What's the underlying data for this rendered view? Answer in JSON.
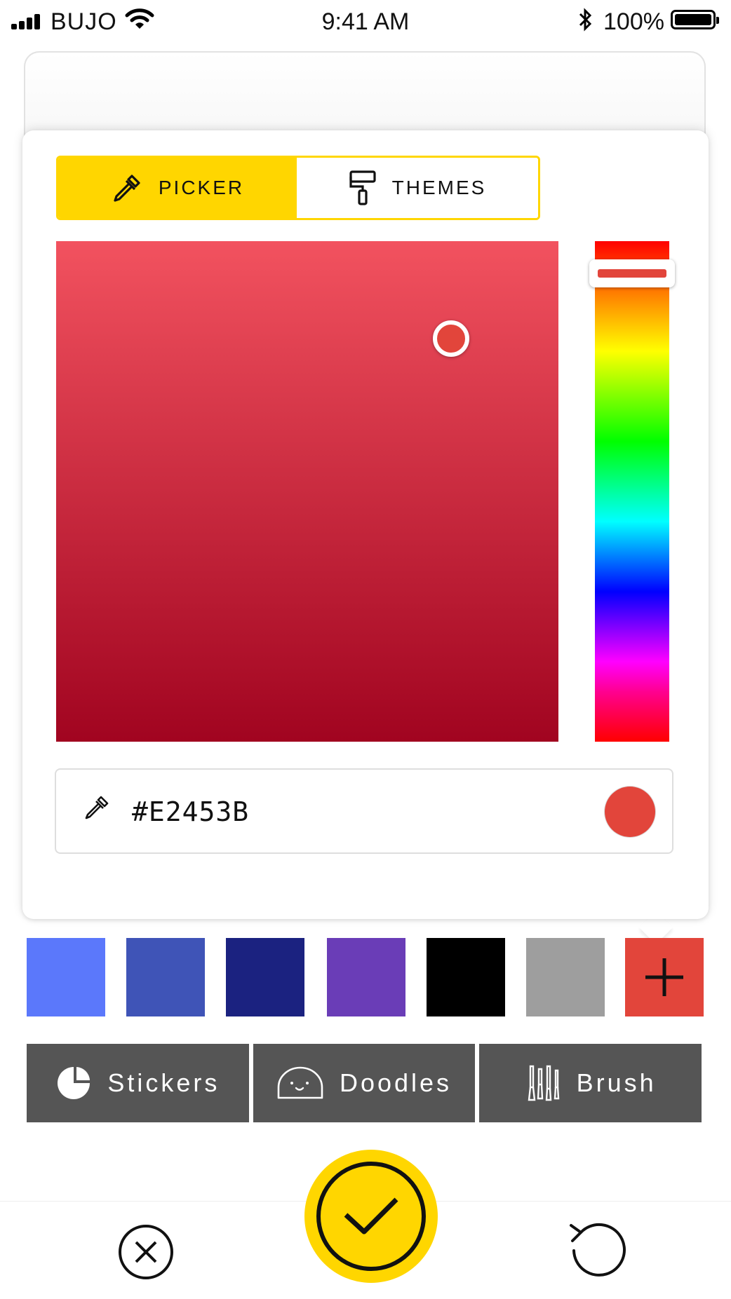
{
  "status_bar": {
    "carrier": "BUJO",
    "time": "9:41 AM",
    "battery": "100%"
  },
  "picker": {
    "tabs": [
      {
        "label": "PICKER",
        "icon": "eyedropper-icon",
        "active": true
      },
      {
        "label": "THEMES",
        "icon": "paint-roller-icon",
        "active": false
      }
    ],
    "hex_value": "#E2453B",
    "selected_color": "#E2453B",
    "accent": "#FFD600"
  },
  "palette": [
    {
      "color": "#5B78FB"
    },
    {
      "color": "#3F54B7"
    },
    {
      "color": "#1B2280"
    },
    {
      "color": "#6A3DB7"
    },
    {
      "color": "#000000"
    },
    {
      "color": "#9E9E9E"
    },
    {
      "color": "#E2453B",
      "icon": "plus-icon"
    }
  ],
  "tools": [
    {
      "label": "Stickers",
      "icon": "sticker-icon"
    },
    {
      "label": "Doodles",
      "icon": "doodle-face-icon"
    },
    {
      "label": "Brush",
      "icon": "brushes-icon"
    }
  ],
  "actions": {
    "cancel": "close-circle-icon",
    "confirm": "check-icon",
    "reset": "undo-icon"
  }
}
